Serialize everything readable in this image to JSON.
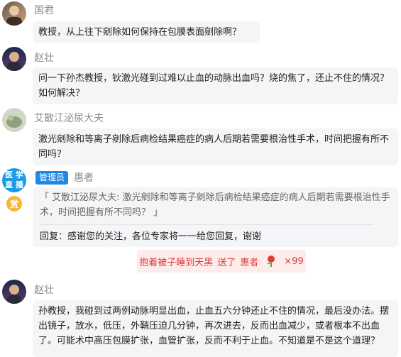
{
  "messages": [
    {
      "name": "国君",
      "text": "教授，从上往下剜除如何保持在包膜表面剜除啊？"
    },
    {
      "name": "赵壮",
      "text": "问一下孙杰教授，钬激光碰到过难以止血的动脉出血吗？烧的焦了，还止不住的情况？如何解决？"
    },
    {
      "name": "艾散江泌尿大夫",
      "text": "激光剜除和等离子剜除后病检结果癌症的病人后期若需要根治性手术，时间把握有所不同吗？"
    },
    {
      "badge": "管理员",
      "name": "惠者",
      "avatar_line1": "医 学",
      "avatar_line2": "直 播",
      "reward_label": "赏",
      "quote": "「 艾散江泌尿大夫: 激光剜除和等离子剜除后病检结果癌症的病人后期若需要根治性手术，时间把握有所不同吗？ 」",
      "reply": "回复：感谢您的关注，各位专家将一一给您回复，谢谢"
    },
    {
      "name": "赵壮",
      "text": "孙教授，我碰到过两例动脉明显出血，止血五六分钟还止不住的情况，最后没办法。摆出镜子，放水，低压，外鞘压迫几分钟，再次进去，反而出血减少，或者根本不出血了。可能术中高压包膜扩张，血管扩张，反而不利于止血。不知道是不是这个道理？"
    }
  ],
  "gift": {
    "sender": "抱着被子睡到天黑",
    "action": "送了",
    "receiver": "惠者",
    "icon": "rose-icon",
    "count": "×99"
  },
  "colors": {
    "badge": "#1e88e5",
    "gift_text": "#e0393e",
    "gift_bg": "#fdecea",
    "bubble": "#f4f5f7"
  }
}
